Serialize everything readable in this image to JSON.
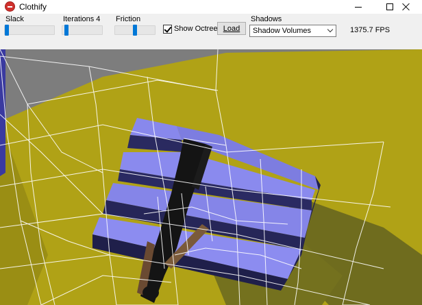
{
  "window": {
    "title": "Clothify"
  },
  "toolbar": {
    "slack": {
      "label": "Slack",
      "value_fraction": 0.0
    },
    "iterations": {
      "label": "Iterations 4",
      "value_fraction": 0.05
    },
    "friction": {
      "label": "Friction",
      "value_fraction": 0.5
    },
    "octree": {
      "label": "Show Octree",
      "checked": true
    },
    "load": {
      "label": "Load"
    },
    "shadows": {
      "label": "Shadows",
      "selected": "Shadow Volumes"
    },
    "fps": "1375.7 FPS"
  },
  "scene": {
    "colors": {
      "floor": "#b0a216",
      "floor_shadow": "#707020",
      "stairs_top": "#8888ec",
      "stairs_side": "#2a2a60",
      "background": "#7d7d7d",
      "octree": "#ffffff"
    }
  },
  "icons": {
    "app": "app-icon",
    "minimize": "minimize-icon",
    "maximize": "maximize-icon",
    "close": "close-icon",
    "dropdown": "chevron-down-icon",
    "check": "check-icon"
  }
}
